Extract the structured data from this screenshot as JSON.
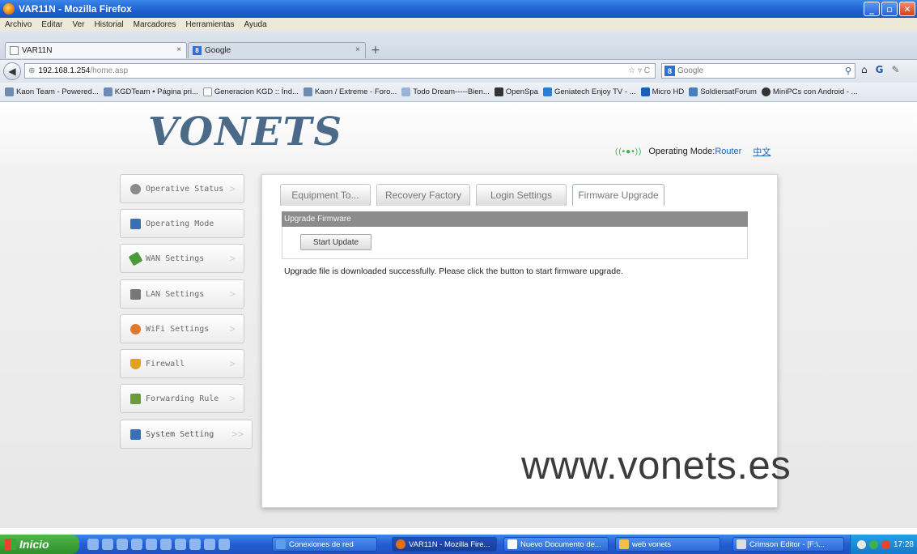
{
  "window": {
    "title": "VAR11N - Mozilla Firefox"
  },
  "menu": [
    "Archivo",
    "Editar",
    "Ver",
    "Historial",
    "Marcadores",
    "Herramientas",
    "Ayuda"
  ],
  "tabs": [
    {
      "label": "VAR11N",
      "close": "×"
    },
    {
      "label": "Google",
      "close": "×"
    }
  ],
  "newtab": "+",
  "nav": {
    "host": "192.168.1.254",
    "path": "/home.asp",
    "search_placeholder": "Google"
  },
  "bookmarks": [
    "Kaon Team - Powered...",
    "KGDTeam • Página pri...",
    "Generacion KGD :: Índ...",
    "Kaon / Extreme - Foro...",
    "Todo Dream-----Bien...",
    "OpenSpa",
    "Geniatech Enjoy TV - ...",
    "Micro HD",
    "SoldiersatForum",
    "MiniPCs con Android - ..."
  ],
  "header": {
    "logo": "VONETS",
    "mode_label": "Operating Mode:",
    "mode_value": "Router",
    "lang_link": "中文"
  },
  "sidebar": [
    {
      "label": "Operative Status",
      "icon": "gear-icon",
      "color": "#8a8a8a"
    },
    {
      "label": "Operating Mode",
      "icon": "monitor-icon",
      "color": "#3a6fb5"
    },
    {
      "label": "WAN Settings",
      "icon": "plug-icon",
      "color": "#4a9a3a"
    },
    {
      "label": "LAN Settings",
      "icon": "network-icon",
      "color": "#777777"
    },
    {
      "label": "WiFi Settings",
      "icon": "wifi-icon",
      "color": "#e07a2a"
    },
    {
      "label": "Firewall",
      "icon": "shield-icon",
      "color": "#e0a020"
    },
    {
      "label": "Forwarding Rule",
      "icon": "forward-icon",
      "color": "#6a9a3a"
    },
    {
      "label": "System Setting",
      "icon": "tools-icon",
      "color": "#3a6fb5"
    }
  ],
  "panel": {
    "tabs": [
      "Equipment To...",
      "Recovery Factory",
      "Login Settings",
      "Firmware Upgrade"
    ],
    "section_title": "Upgrade Firmware",
    "button_label": "Start Update",
    "message": "Upgrade file is downloaded successfully. Please click the button to start firmware upgrade."
  },
  "watermark": "www.vonets.es",
  "taskbar": {
    "start": "Inicio",
    "tasks": [
      "Conexiones de red",
      "VAR11N - Mozilla Fire...",
      "Nuevo Documento de...",
      "web vonets",
      "Crimson Editor - [F:\\..."
    ],
    "clock": "17:28"
  }
}
